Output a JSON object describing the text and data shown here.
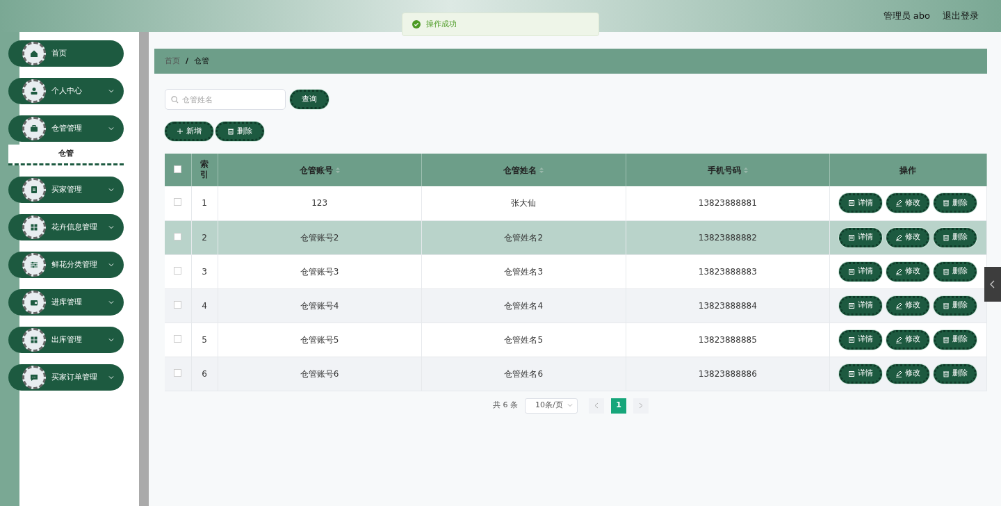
{
  "header": {
    "user": "管理员 abo",
    "logout": "退出登录"
  },
  "toast": {
    "text": "操作成功"
  },
  "sidebar": {
    "items": [
      {
        "label": "首页",
        "kind": "link"
      },
      {
        "label": "个人中心",
        "kind": "group"
      },
      {
        "label": "仓管管理",
        "kind": "group",
        "expanded": true,
        "children": [
          {
            "label": "仓管",
            "selected": true
          }
        ]
      },
      {
        "label": "买家管理",
        "kind": "group"
      },
      {
        "label": "花卉信息管理",
        "kind": "group"
      },
      {
        "label": "鲜花分类管理",
        "kind": "group"
      },
      {
        "label": "进库管理",
        "kind": "group"
      },
      {
        "label": "出库管理",
        "kind": "group"
      },
      {
        "label": "买家订单管理",
        "kind": "group"
      }
    ]
  },
  "breadcrumb": {
    "items": [
      "首页",
      "仓管"
    ],
    "separator": "/"
  },
  "search": {
    "placeholder": "仓管姓名",
    "button": "查询"
  },
  "toolbar": [
    "新增",
    "删除"
  ],
  "table": {
    "select_all": {
      "checked": false
    },
    "columns": [
      {
        "label": "索引",
        "sortable": false
      },
      {
        "label": "仓管账号",
        "sortable": true
      },
      {
        "label": "仓管姓名",
        "sortable": true
      },
      {
        "label": "手机号码",
        "sortable": true
      },
      {
        "label": "操作",
        "sortable": false
      }
    ],
    "rows": [
      {
        "index": "1",
        "account": "123",
        "name": "张大仙",
        "phone": "13823888881",
        "checked": false,
        "hovered": false,
        "actions": [
          "详情",
          "修改",
          "删除"
        ]
      },
      {
        "index": "2",
        "account": "仓管账号2",
        "name": "仓管姓名2",
        "phone": "13823888882",
        "checked": false,
        "hovered": true,
        "actions": [
          "详情",
          "修改",
          "删除"
        ]
      },
      {
        "index": "3",
        "account": "仓管账号3",
        "name": "仓管姓名3",
        "phone": "13823888883",
        "checked": false,
        "hovered": false,
        "actions": [
          "详情",
          "修改",
          "删除"
        ]
      },
      {
        "index": "4",
        "account": "仓管账号4",
        "name": "仓管姓名4",
        "phone": "13823888884",
        "checked": false,
        "hovered": false,
        "actions": [
          "详情",
          "修改",
          "删除"
        ]
      },
      {
        "index": "5",
        "account": "仓管账号5",
        "name": "仓管姓名5",
        "phone": "13823888885",
        "checked": false,
        "hovered": false,
        "actions": [
          "详情",
          "修改",
          "删除"
        ]
      },
      {
        "index": "6",
        "account": "仓管账号6",
        "name": "仓管姓名6",
        "phone": "13823888886",
        "checked": false,
        "hovered": false,
        "actions": [
          "详情",
          "修改",
          "删除"
        ]
      }
    ]
  },
  "pagination": {
    "total": "共 6 条",
    "page_size": "10条/页",
    "pages": [
      {
        "label": "1",
        "selected": true
      }
    ]
  }
}
